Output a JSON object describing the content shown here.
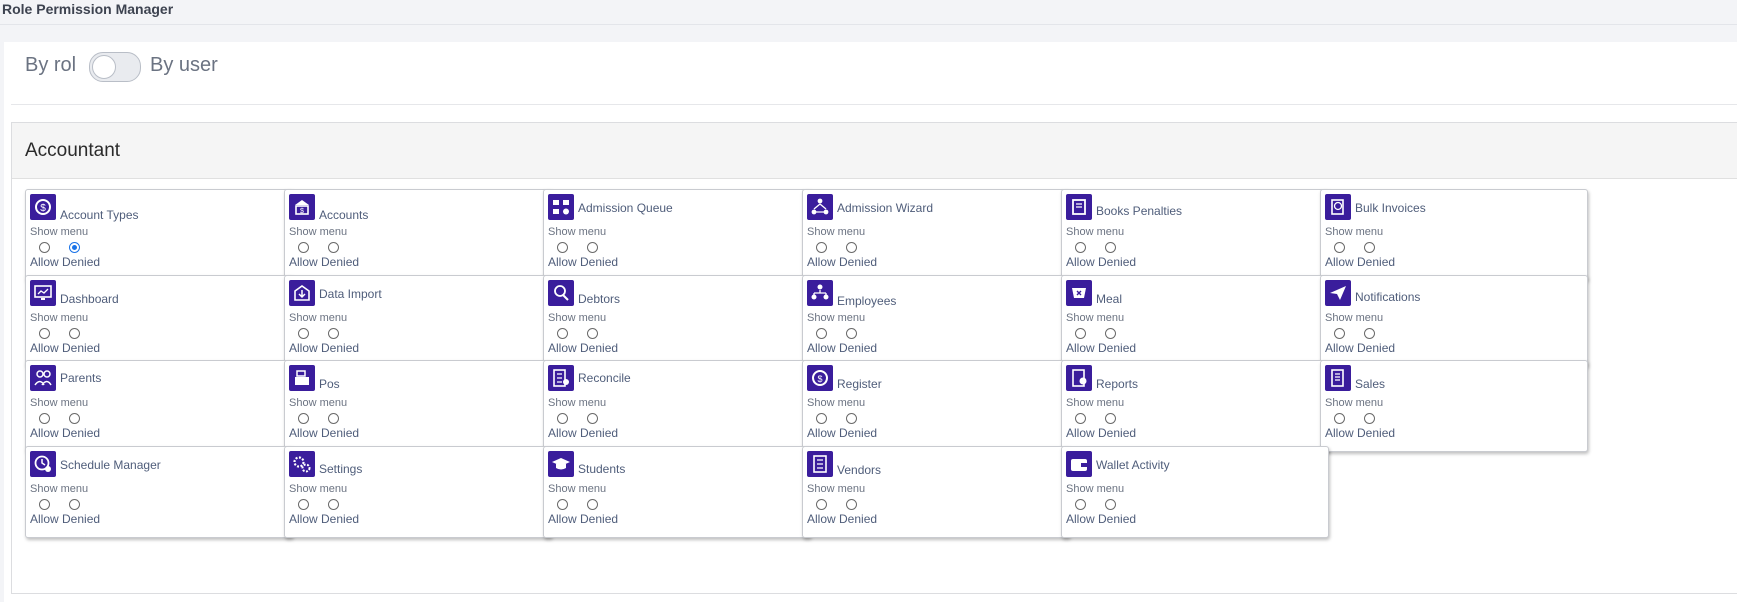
{
  "page": {
    "title": "Role Permission Manager"
  },
  "toggle": {
    "left_label": "By rol",
    "right_label": "By user",
    "checked": false
  },
  "role": {
    "name": "Accountant"
  },
  "labels": {
    "show": "Show menu",
    "allow_denied": "Allow Denied"
  },
  "colors": {
    "icon_bg": "#3a1d9c",
    "link_text": "#4f5d7a",
    "radio_checked": "#1a73e8"
  },
  "modules": [
    {
      "name": "Account Types",
      "icon": "dollar-gear-icon",
      "selection": "denied"
    },
    {
      "name": "Accounts",
      "icon": "bank-dollar-icon",
      "selection": "none"
    },
    {
      "name": "Admission Queue",
      "icon": "queue-icon",
      "selection": "none"
    },
    {
      "name": "Admission Wizard",
      "icon": "people-network-icon",
      "selection": "none"
    },
    {
      "name": "Books Penalties",
      "icon": "book-icon",
      "selection": "none"
    },
    {
      "name": "Bulk Invoices",
      "icon": "invoice-dollar-icon",
      "selection": "none"
    },
    {
      "name": "Dashboard",
      "icon": "dashboard-monitor-icon",
      "selection": "none"
    },
    {
      "name": "Data Import",
      "icon": "import-box-icon",
      "selection": "none"
    },
    {
      "name": "Debtors",
      "icon": "debtor-search-icon",
      "selection": "none"
    },
    {
      "name": "Employees",
      "icon": "org-chart-icon",
      "selection": "none"
    },
    {
      "name": "Meal",
      "icon": "meal-icon",
      "selection": "none"
    },
    {
      "name": "Notifications",
      "icon": "paper-plane-icon",
      "selection": "none"
    },
    {
      "name": "Parents",
      "icon": "parents-icon",
      "selection": "none"
    },
    {
      "name": "Pos",
      "icon": "cash-register-icon",
      "selection": "none"
    },
    {
      "name": "Reconcile",
      "icon": "reconcile-calculator-icon",
      "selection": "none"
    },
    {
      "name": "Register",
      "icon": "register-cycle-icon",
      "selection": "none"
    },
    {
      "name": "Reports",
      "icon": "report-document-icon",
      "selection": "none"
    },
    {
      "name": "Sales",
      "icon": "sales-document-icon",
      "selection": "none"
    },
    {
      "name": "Schedule Manager",
      "icon": "clock-user-icon",
      "selection": "none"
    },
    {
      "name": "Settings",
      "icon": "gears-icon",
      "selection": "none"
    },
    {
      "name": "Students",
      "icon": "graduation-cap-icon",
      "selection": "none"
    },
    {
      "name": "Vendors",
      "icon": "vendor-list-icon",
      "selection": "none"
    },
    {
      "name": "Wallet Activity",
      "icon": "wallet-icon",
      "selection": "none"
    }
  ]
}
